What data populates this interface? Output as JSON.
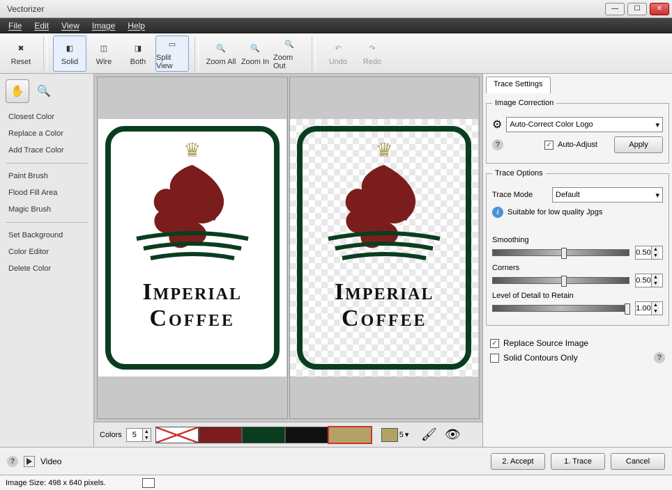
{
  "window": {
    "title": "Vectorizer"
  },
  "menu": [
    "File",
    "Edit",
    "View",
    "Image",
    "Help"
  ],
  "toolbar": [
    {
      "label": "Reset",
      "icon": "reset",
      "active": false
    },
    {
      "label": "Solid",
      "icon": "solid",
      "active": true
    },
    {
      "label": "Wire",
      "icon": "wire",
      "active": false
    },
    {
      "label": "Both",
      "icon": "both",
      "active": false
    },
    {
      "label": "Split View",
      "icon": "split",
      "active": true
    },
    {
      "label": "Zoom All",
      "icon": "zoomall",
      "active": false
    },
    {
      "label": "Zoom In",
      "icon": "zoomin",
      "active": false
    },
    {
      "label": "Zoom Out",
      "icon": "zoomout",
      "active": false
    },
    {
      "label": "Undo",
      "icon": "undo",
      "disabled": true
    },
    {
      "label": "Redo",
      "icon": "redo",
      "disabled": true
    }
  ],
  "sidebar": {
    "groups": [
      [
        "Closest Color",
        "Replace a Color",
        "Add Trace Color"
      ],
      [
        "Paint Brush",
        "Flood Fill Area",
        "Magic Brush"
      ],
      [
        "Set Background",
        "Color Editor",
        "Delete Color"
      ]
    ]
  },
  "logo": {
    "line1": "Imperial",
    "line2": "Coffee"
  },
  "colors": {
    "label": "Colors",
    "count": "5",
    "swatches": [
      "#ffffff",
      "#7b1d1d",
      "#0a3d1e",
      "#111111",
      "#b3a264"
    ],
    "selected": "#b3a264",
    "selected_count": "5"
  },
  "panel": {
    "tab": "Trace Settings",
    "image_correction": {
      "legend": "Image Correction",
      "mode": "Auto-Correct Color Logo",
      "auto_adjust_label": "Auto-Adjust",
      "auto_adjust": true,
      "apply_label": "Apply"
    },
    "trace_options": {
      "legend": "Trace Options",
      "mode_label": "Trace Mode",
      "mode": "Default",
      "hint": "Suitable for low quality Jpgs",
      "smoothing_label": "Smoothing",
      "smoothing": "0.50",
      "corners_label": "Corners",
      "corners": "0.50",
      "detail_label": "Level of Detail to Retain",
      "detail": "1.00"
    },
    "replace_source_label": "Replace Source Image",
    "replace_source": true,
    "solid_contours_label": "Solid Contours Only",
    "solid_contours": false
  },
  "bottom": {
    "video": "Video",
    "accept": "2. Accept",
    "trace": "1. Trace",
    "cancel": "Cancel"
  },
  "status": {
    "text": "Image Size: 498 x 640 pixels."
  }
}
